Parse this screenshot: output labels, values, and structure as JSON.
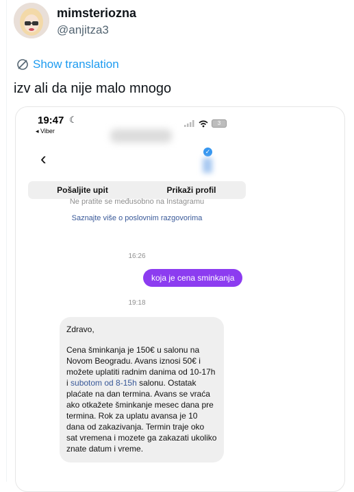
{
  "tweet": {
    "user_name": "mimsteriozna",
    "handle": "@anjitza3",
    "show_translation": "Show translation",
    "text": "izv ali da nije malo mnogo"
  },
  "screenshot": {
    "status_time": "19:47",
    "back_app": "◂ Viber",
    "buttons": {
      "send_request": "Pošaljite upit",
      "show_profile": "Prikaži profil"
    },
    "not_following": "Ne pratite se međusobno na Instagramu",
    "business_link": "Saznajte više o poslovnim razgovorima",
    "time_sent": "16:26",
    "sent_message": "koja je cena sminkanja",
    "time_reply": "19:18",
    "reply": {
      "greeting": "Zdravo,",
      "line1": "Cena šminkanja je 150€ u salonu na Novom Beogradu. Avans iznosi 50€ i možete uplatiti radnim danima  od 10-17h i",
      "link": "subotom od 8-15h",
      "line2": "salonu. Ostatak plaćate na dan termina. Avans se vraća ako otkažete šminkanje mesec dana pre termina. Rok za uplatu avansa je 10 dana od zakazivanja. Termin traje oko sat vremena i mozete ga zakazati ukoliko znate datum i vreme."
    }
  },
  "colors": {
    "link_blue": "#1d9bf0",
    "ig_purple": "#8c3cf0"
  }
}
